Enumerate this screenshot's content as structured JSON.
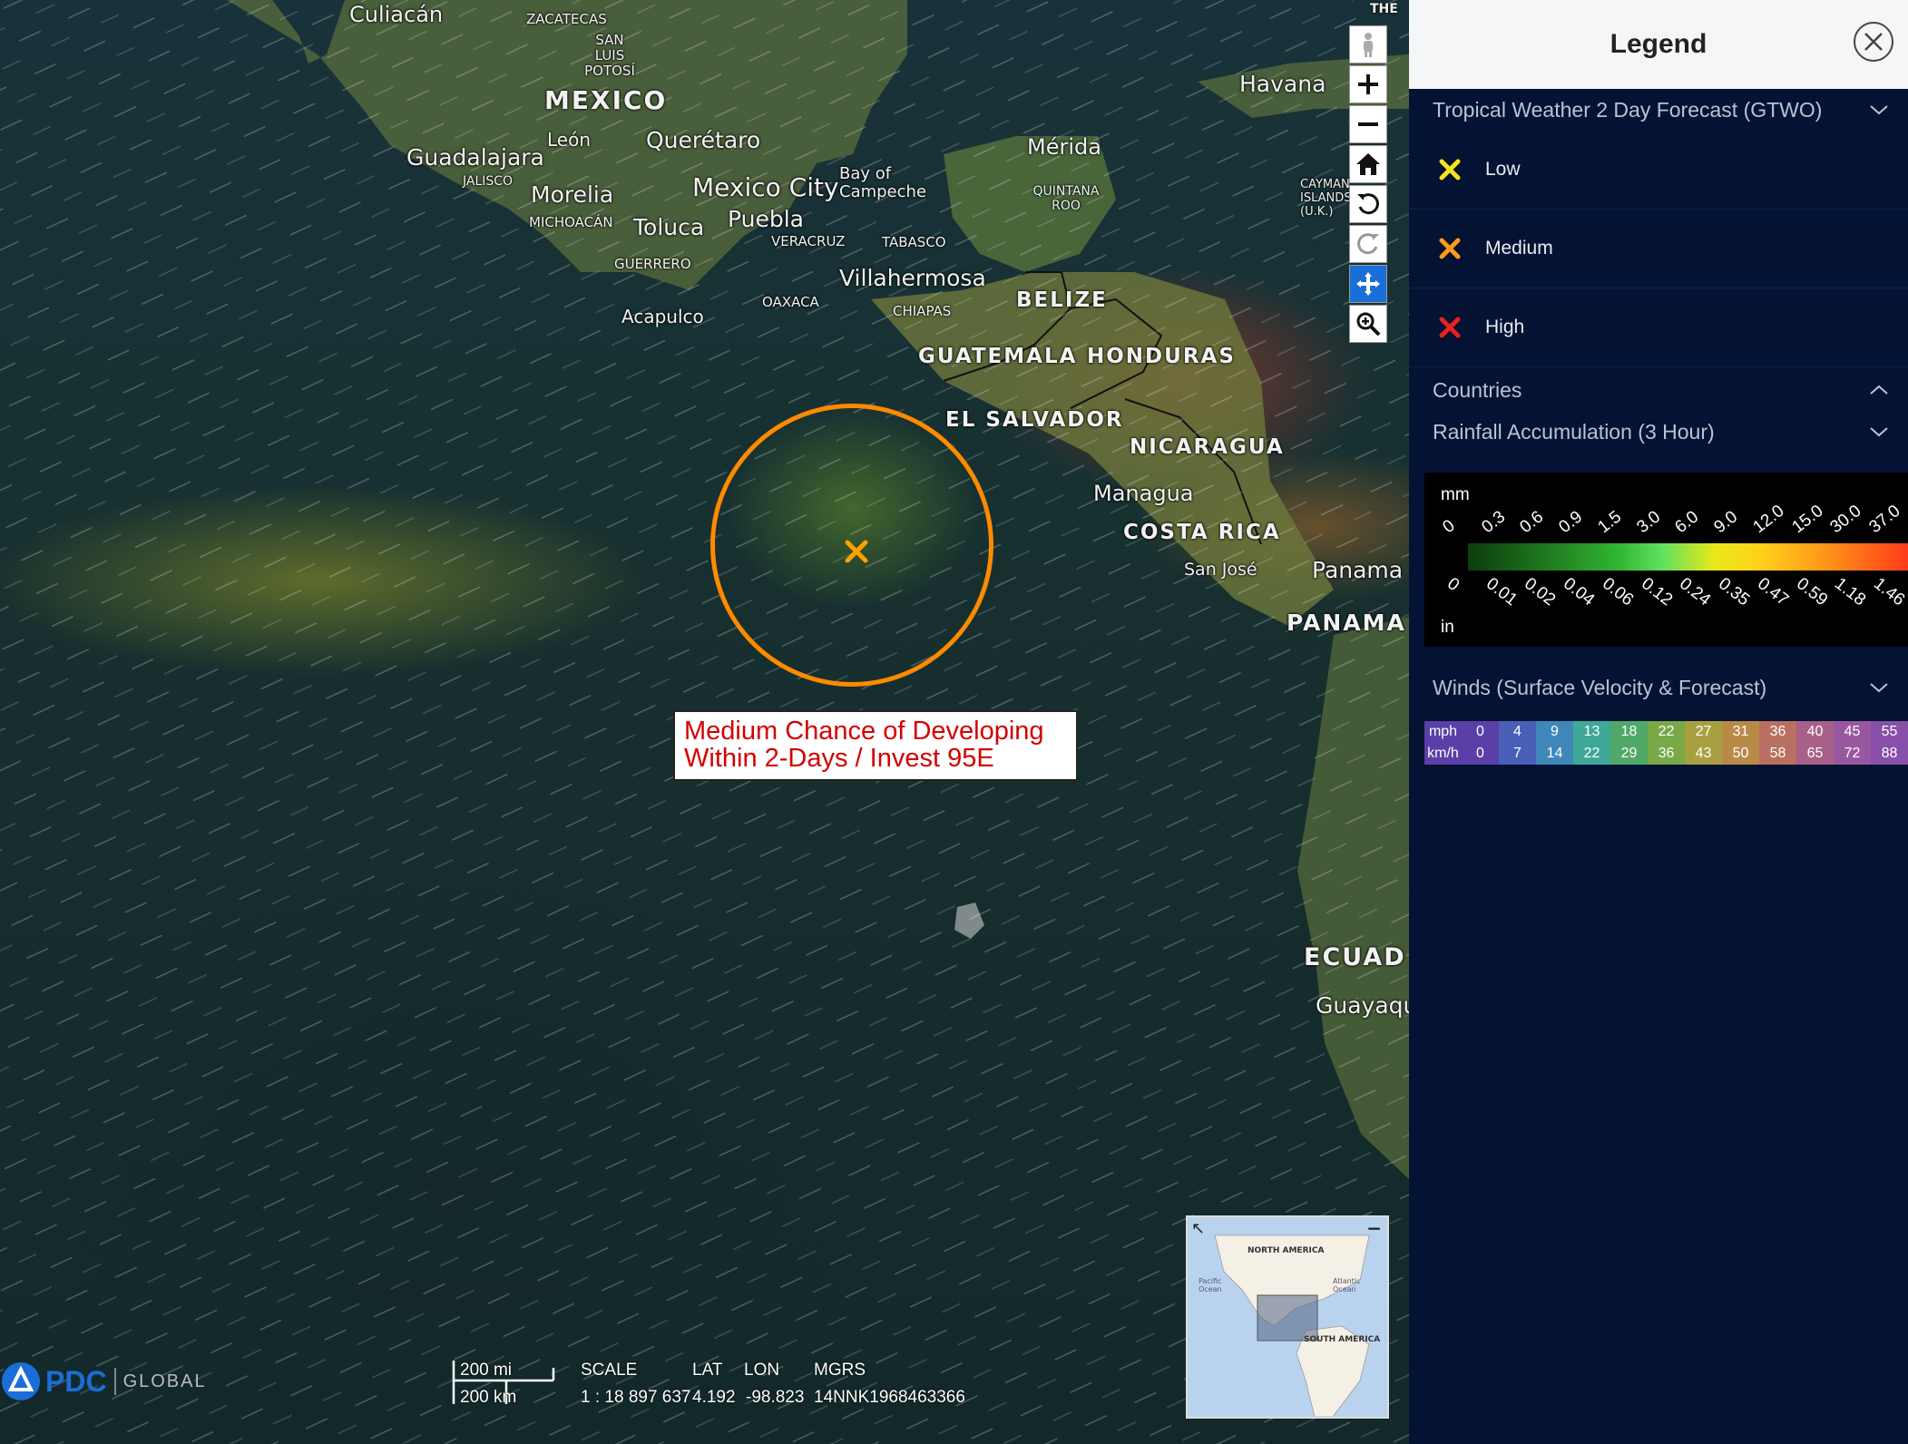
{
  "map": {
    "labels": {
      "culiacan": "Culiacán",
      "zacatecas": "ZACATECAS",
      "san_luis": "SAN LUIS POTOSÍ",
      "mexico": "MEXICO",
      "leon": "León",
      "queretaro": "Querétaro",
      "guadalajara": "Guadalajara",
      "jalisco": "JALISCO",
      "morelia": "Morelia",
      "michoacan": "MICHOACÁN",
      "mexico_city": "Mexico City",
      "toluca": "Toluca",
      "puebla": "Puebla",
      "guerrero": "GUERRERO",
      "veracruz": "VERACRUZ",
      "bay_campeche": "Bay of Campeche",
      "acapulco": "Acapulco",
      "oaxaca": "OAXACA",
      "tabasco": "TABASCO",
      "villahermosa": "Villahermosa",
      "chiapas": "CHIAPAS",
      "merida": "Mérida",
      "quintana_roo": "QUINTANA ROO",
      "havana": "Havana",
      "cayman": "CAYMAN ISLANDS (U.K.)",
      "belize": "BELIZE",
      "guatemala": "GUATEMALA",
      "honduras": "HONDURAS",
      "el_salvador": "EL SALVADOR",
      "nicaragua": "NICARAGUA",
      "managua": "Managua",
      "costa_rica": "COSTA RICA",
      "san_jose": "San José",
      "panama_city": "Panama",
      "panama": "PANAMA",
      "ecuador": "ECUAD",
      "guayaquil": "Guayaqu",
      "the": "THE"
    },
    "annotation": {
      "line1": "Medium Chance of Developing",
      "line2": "Within 2-Days / Invest 95E",
      "circle_color": "#ff8a00",
      "marker_color": "#ffa000"
    },
    "scalebar": {
      "mi": "200 mi",
      "km": "200 km"
    },
    "readout": {
      "scale_label": "SCALE",
      "scale_value": "1 : 18 897 637",
      "lat_label": "LAT",
      "lat_value": "4.192",
      "lon_label": "LON",
      "lon_value": "-98.823",
      "mgrs_label": "MGRS",
      "mgrs_value": "14NNK1968463366"
    },
    "minimap": {
      "north_america": "NORTH AMERICA",
      "pacific": "Pacific Ocean",
      "atlantic": "Atlantic Ocean",
      "south_america": "SOUTH AMERICA"
    },
    "logo": {
      "brand": "PDC",
      "global": "GLOBAL"
    }
  },
  "toolbar": {
    "icons": [
      "streetview-icon",
      "zoom-in-icon",
      "zoom-out-icon",
      "home-icon",
      "undo-icon",
      "redo-icon",
      "pan-icon",
      "zoom-box-icon"
    ]
  },
  "legend": {
    "title": "Legend",
    "sections": {
      "gtwo": "Tropical Weather 2 Day Forecast (GTWO)",
      "countries": "Countries",
      "rainfall": "Rainfall Accumulation (3 Hour)",
      "winds": "Winds (Surface Velocity & Forecast)"
    },
    "gtwo_items": [
      {
        "label": "Low",
        "color": "#f5e31a"
      },
      {
        "label": "Medium",
        "color": "#ff9a1a"
      },
      {
        "label": "High",
        "color": "#e82020"
      }
    ],
    "rainfall": {
      "unit_top": "mm",
      "unit_bottom": "in",
      "mm_ticks": [
        "0",
        "0.3",
        "0.6",
        "0.9",
        "1.5",
        "3.0",
        "6.0",
        "9.0",
        "12.0",
        "15.0",
        "30.0",
        "37.0"
      ],
      "in_ticks": [
        "0",
        "0.01",
        "0.02",
        "0.04",
        "0.06",
        "0.12",
        "0.24",
        "0.35",
        "0.47",
        "0.59",
        "1.18",
        "1.46"
      ]
    },
    "winds": {
      "mph_label": "mph",
      "kmh_label": "km/h",
      "mph": [
        "0",
        "4",
        "9",
        "13",
        "18",
        "22",
        "27",
        "31",
        "36",
        "40",
        "45",
        "55"
      ],
      "kmh": [
        "0",
        "7",
        "14",
        "22",
        "29",
        "36",
        "43",
        "50",
        "58",
        "65",
        "72",
        "88"
      ],
      "colors": [
        "#5a3fa8",
        "#4a5fb8",
        "#3f87b8",
        "#3fa898",
        "#4fa868",
        "#78a848",
        "#a8a040",
        "#b88a48",
        "#b87060",
        "#a86088",
        "#9858a0",
        "#8850a8"
      ]
    }
  }
}
